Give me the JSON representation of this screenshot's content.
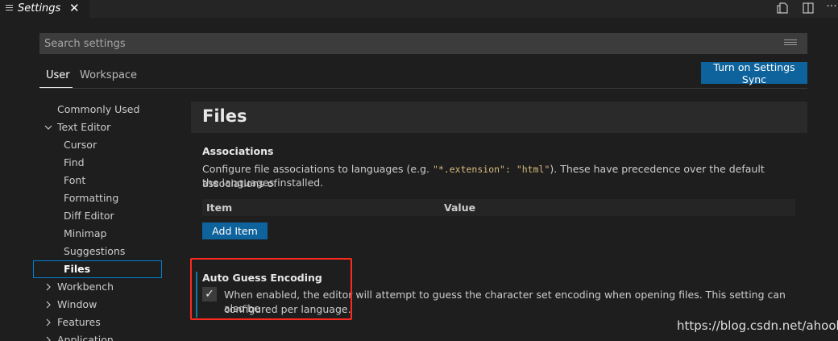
{
  "tab": {
    "title": "Settings",
    "close_glyph": "✕",
    "icon": "settings-list-icon"
  },
  "editor_actions": {
    "open_json": "open-json-icon",
    "split": "split-editor-icon",
    "more": "···"
  },
  "search": {
    "placeholder": "Search settings",
    "value": ""
  },
  "scopes": [
    {
      "label": "User",
      "active": true
    },
    {
      "label": "Workspace",
      "active": false
    }
  ],
  "sync_button": {
    "label": "Turn on Settings Sync"
  },
  "toc": [
    {
      "label": "Commonly Used",
      "chevron": ""
    },
    {
      "label": "Text Editor",
      "chevron": "down"
    },
    {
      "label": "Cursor",
      "chevron": ""
    },
    {
      "label": "Find",
      "chevron": ""
    },
    {
      "label": "Font",
      "chevron": ""
    },
    {
      "label": "Formatting",
      "chevron": ""
    },
    {
      "label": "Diff Editor",
      "chevron": ""
    },
    {
      "label": "Minimap",
      "chevron": ""
    },
    {
      "label": "Suggestions",
      "chevron": ""
    },
    {
      "label": "Files",
      "chevron": "",
      "selected": true
    },
    {
      "label": "Workbench",
      "chevron": "right"
    },
    {
      "label": "Window",
      "chevron": "right"
    },
    {
      "label": "Features",
      "chevron": "right"
    },
    {
      "label": "Application",
      "chevron": "right"
    }
  ],
  "section": {
    "title": "Files"
  },
  "associations": {
    "title": "Associations",
    "desc_before": "Configure file associations to languages (e.g. ",
    "code1": "\"*.extension\": \"html\"",
    "desc_after": "). These have precedence over the default associations of",
    "desc_line2": "the languages installed.",
    "columns": [
      "Item",
      "Value"
    ],
    "add_button": "Add Item"
  },
  "auto_guess": {
    "title": "Auto Guess Encoding",
    "checked": true,
    "check_glyph": "✓",
    "desc_line1": "When enabled, the editor will attempt to guess the character set encoding when opening files. This setting can also be",
    "desc_line2": "configured per language."
  },
  "watermark": "https://blog.csdn.net/ahook",
  "colors": {
    "accent": "#0e639c",
    "focus_border": "#007fd4",
    "highlight": "#ff2a1f"
  }
}
